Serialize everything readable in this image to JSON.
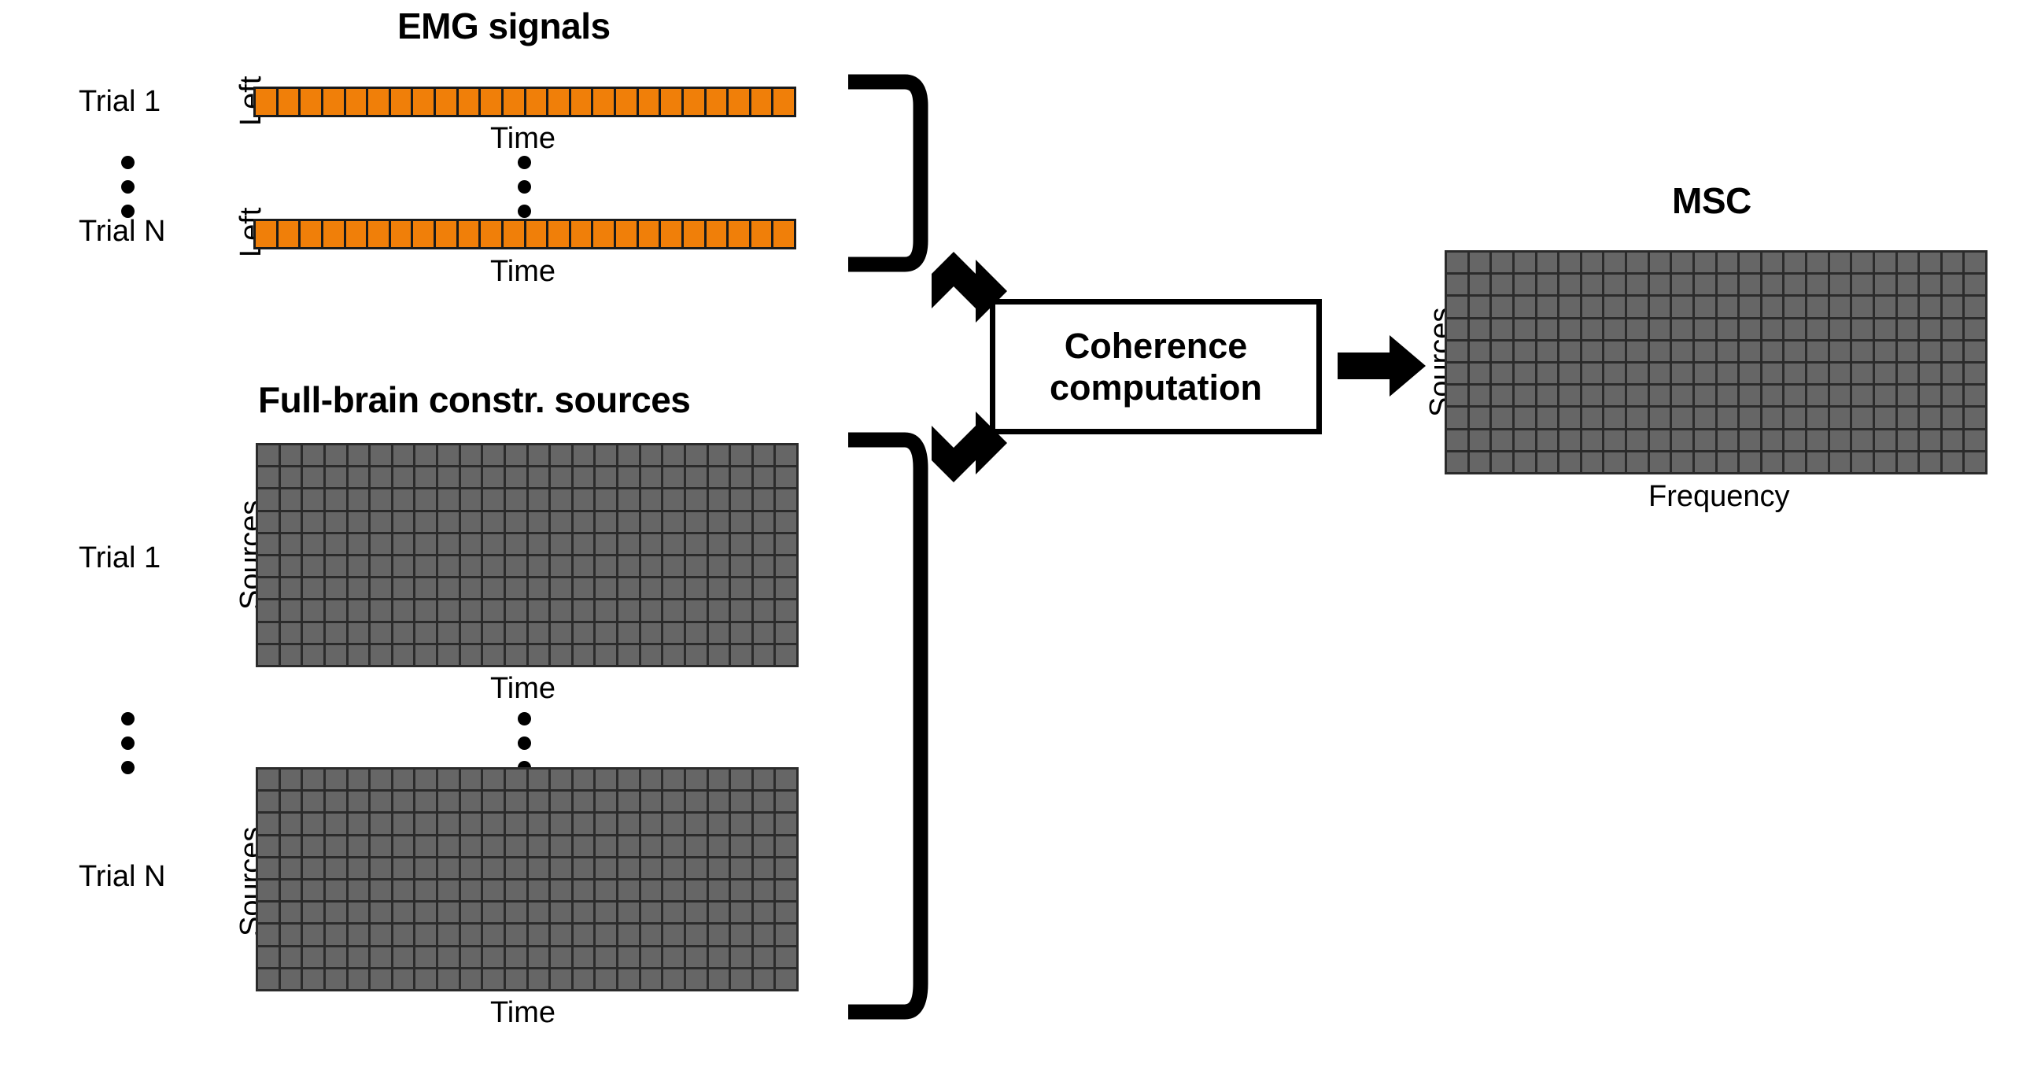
{
  "figure": {
    "type": "pipeline-diagram",
    "background": "#ffffff",
    "colors": {
      "emg_cell": "#F07F09",
      "matrix_cell": "#666666",
      "gridline": "#2b2b2b",
      "stroke": "#000000"
    }
  },
  "emg_panel": {
    "title": "EMG signals",
    "trials": [
      {
        "trial_label": "Trial 1",
        "row_label": "Left",
        "x_axis_label": "Time",
        "n_cells": 24
      },
      {
        "trial_label": "Trial N",
        "row_label": "Left",
        "x_axis_label": "Time",
        "n_cells": 24
      }
    ],
    "ellipsis_glyph": "vertical-three-dots"
  },
  "sources_panel": {
    "title": "Full-brain constr. sources",
    "trials": [
      {
        "trial_label": "Trial 1",
        "y_axis_label": "Sources",
        "x_axis_label": "Time",
        "n_rows": 10,
        "n_cols": 24
      },
      {
        "trial_label": "Trial N",
        "y_axis_label": "Sources",
        "x_axis_label": "Time",
        "n_rows": 10,
        "n_cols": 24
      }
    ],
    "ellipsis_glyph": "vertical-three-dots"
  },
  "process": {
    "label_line1": "Coherence",
    "label_line2": "computation"
  },
  "output_panel": {
    "title": "MSC",
    "y_axis_label": "Sources",
    "x_axis_label": "Frequency",
    "n_rows": 10,
    "n_cols": 24
  },
  "connectors": {
    "top_bracket": "right-bracket",
    "bottom_bracket": "right-bracket",
    "arrow_top": "arrow-down-right-icon",
    "arrow_bottom": "arrow-up-right-icon",
    "arrow_out": "arrow-right-icon"
  },
  "chart_data": {
    "type": "heatmap",
    "title": "MSC",
    "xlabel": "Frequency",
    "ylabel": "Sources",
    "grid": true,
    "rows": 10,
    "cols": 24,
    "uniform_value_color": "#666666"
  }
}
